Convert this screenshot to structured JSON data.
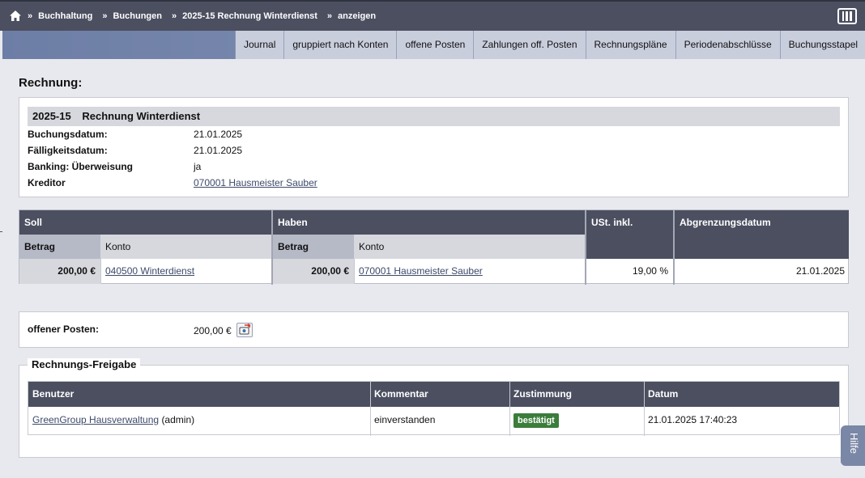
{
  "breadcrumb": {
    "items": [
      "Buchhaltung",
      "Buchungen",
      "2025-15 Rechnung Winterdienst",
      "anzeigen"
    ],
    "separator": "»"
  },
  "tabs": [
    "Journal",
    "gruppiert nach Konten",
    "offene Posten",
    "Zahlungen off. Posten",
    "Rechnungspläne",
    "Periodenabschlüsse",
    "Buchungsstapel"
  ],
  "page_title": "Rechnung:",
  "invoice": {
    "number": "2025-15",
    "title": "Rechnung Winterdienst",
    "fields": [
      {
        "label": "Buchungsdatum:",
        "value": "21.01.2025"
      },
      {
        "label": "Fälligkeitsdatum:",
        "value": "21.01.2025"
      },
      {
        "label": "Banking: Überweisung",
        "value": "ja"
      },
      {
        "label": "Kreditor",
        "value": "070001 Hausmeister Sauber"
      }
    ]
  },
  "booking": {
    "soll_header": "Soll",
    "haben_header": "Haben",
    "ust_header": "USt. inkl.",
    "abgrenzung_header": "Abgrenzungsdatum",
    "betrag_header": "Betrag",
    "konto_header": "Konto",
    "soll_betrag": "200,00 €",
    "soll_konto": "040500 Winterdienst",
    "haben_betrag": "200,00 €",
    "haben_konto": "070001 Hausmeister Sauber",
    "ust": "19,00 %",
    "abgrenzungsdatum": "21.01.2025"
  },
  "open_item": {
    "label": "offener Posten:",
    "value": "200,00 €"
  },
  "approval": {
    "legend": "Rechnungs-Freigabe",
    "headers": [
      "Benutzer",
      "Kommentar",
      "Zustimmung",
      "Datum"
    ],
    "row": {
      "user_link": "GreenGroup Hausverwaltung",
      "user_role": "(admin)",
      "comment": "einverstanden",
      "status": "bestätigt",
      "date": "21.01.2025 17:40:23"
    }
  },
  "help_label": "Hilfe",
  "colors": {
    "header_dark": "#4b4f60",
    "status_green": "#3b7d3a",
    "tab_bg": "#c9cedd"
  }
}
